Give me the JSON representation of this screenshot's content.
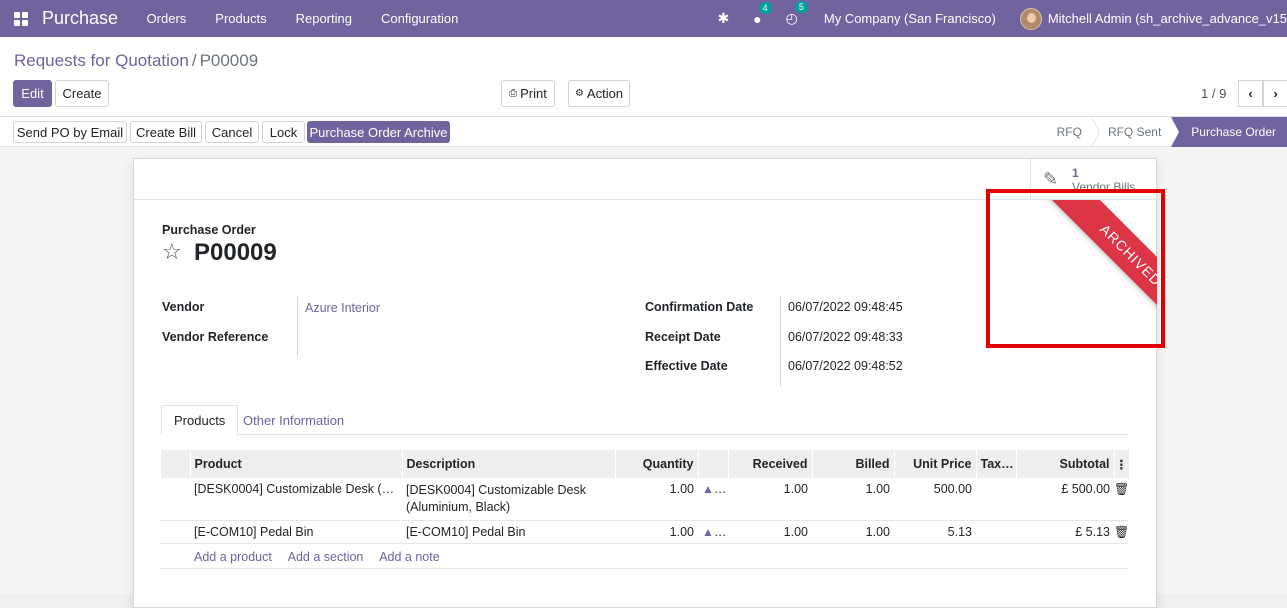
{
  "navbar": {
    "app_name": "Purchase",
    "menu": [
      "Orders",
      "Products",
      "Reporting",
      "Configuration"
    ],
    "messages_badge": "4",
    "activity_badge": "5",
    "company": "My Company (San Francisco)",
    "user": "Mitchell Admin (sh_archive_advance_v15"
  },
  "breadcrumb": {
    "parent": "Requests for Quotation",
    "separator": "/",
    "current": "P00009"
  },
  "toolbar": {
    "edit": "Edit",
    "create": "Create",
    "print": "Print",
    "action": "Action",
    "pager": "1 / 9"
  },
  "statusbar": {
    "buttons": [
      "Send PO by Email",
      "Create Bill",
      "Cancel",
      "Lock",
      "Purchase Order Archive"
    ],
    "stages": [
      "RFQ",
      "RFQ Sent",
      "Purchase Order"
    ]
  },
  "smart_button": {
    "count": "1",
    "label": "Vendor Bills"
  },
  "ribbon": "ARCHIVED",
  "form": {
    "title_label": "Purchase Order",
    "name": "P00009",
    "vendor_label": "Vendor",
    "vendor_value": "Azure Interior",
    "vendor_ref_label": "Vendor Reference",
    "confirmation_label": "Confirmation Date",
    "confirmation_value": "06/07/2022 09:48:45",
    "receipt_label": "Receipt Date",
    "receipt_value": "06/07/2022 09:48:33",
    "effective_label": "Effective Date",
    "effective_value": "06/07/2022 09:48:52"
  },
  "tabs": [
    "Products",
    "Other Information"
  ],
  "lines": {
    "headers": [
      "Product",
      "Description",
      "Quantity",
      "Received",
      "Billed",
      "Unit Price",
      "Tax…",
      "Subtotal"
    ],
    "rows": [
      {
        "product": "[DESK0004] Customizable Desk (Alu…",
        "description": "[DESK0004] Customizable Desk (Aluminium, Black)",
        "quantity": "1.00",
        "received": "1.00",
        "billed": "1.00",
        "unit_price": "500.00",
        "taxes": "",
        "subtotal": "£ 500.00"
      },
      {
        "product": "[E-COM10] Pedal Bin",
        "description": "[E-COM10] Pedal Bin",
        "quantity": "1.00",
        "received": "1.00",
        "billed": "1.00",
        "unit_price": "5.13",
        "taxes": "",
        "subtotal": "£ 5.13"
      }
    ],
    "add_links": [
      "Add a product",
      "Add a section",
      "Add a note"
    ]
  }
}
